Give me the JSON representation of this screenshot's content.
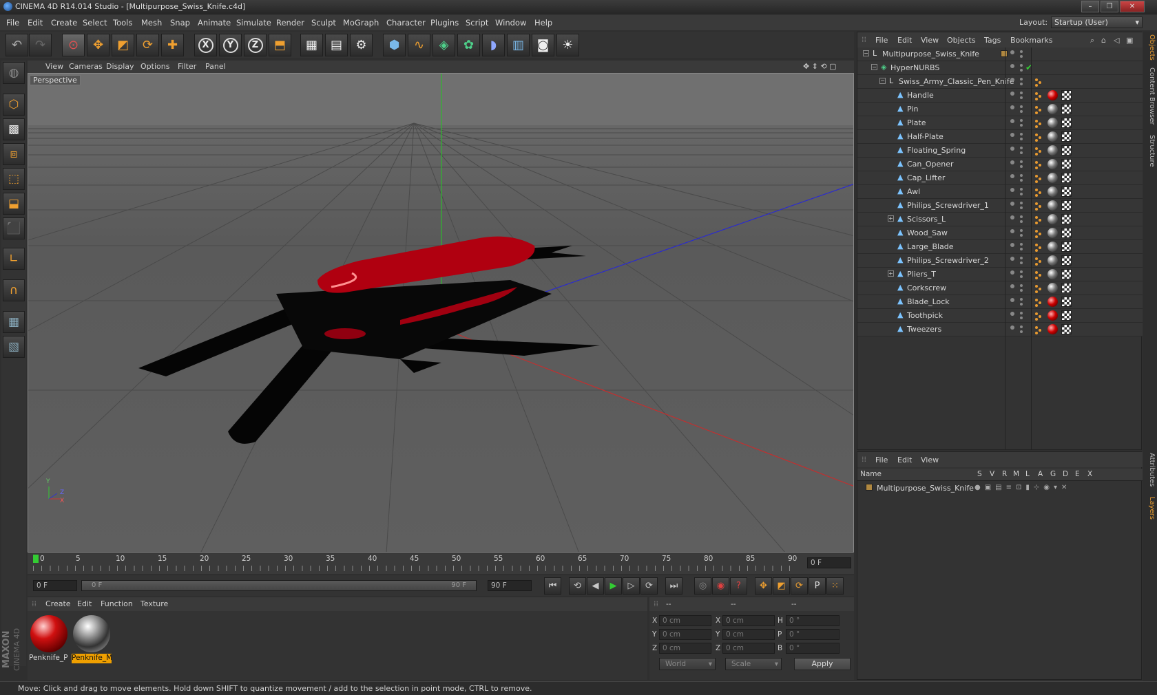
{
  "window": {
    "title": "CINEMA 4D R14.014 Studio - [Multipurpose_Swiss_Knife.c4d]",
    "controls": [
      "–",
      "❐",
      "✕"
    ]
  },
  "menubar": {
    "items": [
      "File",
      "Edit",
      "Create",
      "Select",
      "Tools",
      "Mesh",
      "Snap",
      "Animate",
      "Simulate",
      "Render",
      "Sculpt",
      "MoGraph",
      "Character",
      "Plugins",
      "Script",
      "Window",
      "Help"
    ],
    "layout_label": "Layout:",
    "layout_value": "Startup (User)"
  },
  "toolbar": {
    "icons": [
      "undo-icon",
      "redo-icon",
      "live-selection-icon",
      "move-icon",
      "scale-icon",
      "rotate-icon",
      "add-icon",
      "x-axis-icon",
      "y-axis-icon",
      "z-axis-icon",
      "coordinate-system-icon",
      "render-view-icon",
      "render-picture-viewer-icon",
      "render-settings-icon",
      "cube-icon",
      "spline-icon",
      "nurbs-icon",
      "array-icon",
      "deformer-icon",
      "floor-icon",
      "camera-icon",
      "light-icon"
    ],
    "axis_labels": [
      "X",
      "Y",
      "Z"
    ]
  },
  "viewport": {
    "menu": [
      "View",
      "Cameras",
      "Display",
      "Options",
      "Filter",
      "Panel"
    ],
    "label": "Perspective",
    "axis_labels": [
      "Y",
      "Z",
      "X"
    ]
  },
  "timeline": {
    "ticks": [
      "0",
      "5",
      "10",
      "15",
      "20",
      "25",
      "30",
      "35",
      "40",
      "45",
      "50",
      "55",
      "60",
      "65",
      "70",
      "75",
      "80",
      "85",
      "90"
    ],
    "current_frame": "0 F",
    "start_field": "0 F",
    "range_start": "0 F",
    "range_end": "90 F",
    "end_field": "90 F"
  },
  "materials": {
    "menu": [
      "Create",
      "Edit",
      "Function",
      "Texture"
    ],
    "items": [
      {
        "name": "Penknife_P",
        "selected": false
      },
      {
        "name": "Penknife_M",
        "selected": true
      }
    ]
  },
  "coordinates": {
    "headers": [
      "--",
      "--",
      "--"
    ],
    "rows": [
      {
        "a": "X",
        "av": "0 cm",
        "b": "X",
        "bv": "0 cm",
        "c": "H",
        "cv": "0 °"
      },
      {
        "a": "Y",
        "av": "0 cm",
        "b": "Y",
        "bv": "0 cm",
        "c": "P",
        "cv": "0 °"
      },
      {
        "a": "Z",
        "av": "0 cm",
        "b": "Z",
        "bv": "0 cm",
        "c": "B",
        "cv": "0 °"
      }
    ],
    "world": "World",
    "scale": "Scale",
    "apply": "Apply"
  },
  "objects": {
    "menu": [
      "File",
      "Edit",
      "View",
      "Objects",
      "Tags",
      "Bookmarks"
    ],
    "rows": [
      {
        "name": "Multipurpose_Swiss_Knife",
        "indent": 0,
        "icon": "null-icon",
        "tag": "none"
      },
      {
        "name": "HyperNURBS",
        "indent": 1,
        "icon": "hypernurbs-icon",
        "tag": "check"
      },
      {
        "name": "Swiss_Army_Classic_Pen_Knife",
        "indent": 2,
        "icon": "null-icon",
        "tag": "none"
      },
      {
        "name": "Handle",
        "indent": 3,
        "icon": "polygon-icon",
        "tag": "red"
      },
      {
        "name": "Pin",
        "indent": 3,
        "icon": "polygon-icon",
        "tag": "chrome"
      },
      {
        "name": "Plate",
        "indent": 3,
        "icon": "polygon-icon",
        "tag": "chrome"
      },
      {
        "name": "Half-Plate",
        "indent": 3,
        "icon": "polygon-icon",
        "tag": "chrome"
      },
      {
        "name": "Floating_Spring",
        "indent": 3,
        "icon": "polygon-icon",
        "tag": "chrome"
      },
      {
        "name": "Can_Opener",
        "indent": 3,
        "icon": "polygon-icon",
        "tag": "chrome"
      },
      {
        "name": "Cap_Lifter",
        "indent": 3,
        "icon": "polygon-icon",
        "tag": "chrome"
      },
      {
        "name": "Awl",
        "indent": 3,
        "icon": "polygon-icon",
        "tag": "chrome"
      },
      {
        "name": "Philips_Screwdriver_1",
        "indent": 3,
        "icon": "polygon-icon",
        "tag": "chrome"
      },
      {
        "name": "Scissors_L",
        "indent": 3,
        "icon": "polygon-icon",
        "tag": "chrome",
        "expand": true
      },
      {
        "name": "Wood_Saw",
        "indent": 3,
        "icon": "polygon-icon",
        "tag": "chrome"
      },
      {
        "name": "Large_Blade",
        "indent": 3,
        "icon": "polygon-icon",
        "tag": "chrome"
      },
      {
        "name": "Philips_Screwdriver_2",
        "indent": 3,
        "icon": "polygon-icon",
        "tag": "chrome"
      },
      {
        "name": "Pliers_T",
        "indent": 3,
        "icon": "polygon-icon",
        "tag": "chrome",
        "expand": true
      },
      {
        "name": "Corkscrew",
        "indent": 3,
        "icon": "polygon-icon",
        "tag": "chrome"
      },
      {
        "name": "Blade_Lock",
        "indent": 3,
        "icon": "polygon-icon",
        "tag": "red"
      },
      {
        "name": "Toothpick",
        "indent": 3,
        "icon": "polygon-icon",
        "tag": "red"
      },
      {
        "name": "Tweezers",
        "indent": 3,
        "icon": "polygon-icon",
        "tag": "red"
      }
    ]
  },
  "layers": {
    "menu": [
      "File",
      "Edit",
      "View"
    ],
    "columns": [
      "Name",
      "S",
      "V",
      "R",
      "M",
      "L",
      "A",
      "G",
      "D",
      "E",
      "X"
    ],
    "rows": [
      {
        "name": "Multipurpose_Swiss_Knife"
      }
    ]
  },
  "right_tabs": [
    "Objects",
    "Content Browser",
    "Structure",
    "Attributes",
    "Layers"
  ],
  "status": {
    "text": "Move: Click and drag to move elements. Hold down SHIFT to quantize movement / add to the selection in point mode, CTRL to remove."
  },
  "brand": {
    "line1": "MAXON",
    "line2": "CINEMA 4D"
  },
  "colors": {
    "accent": "#f0a030",
    "handle_red": "#b00010",
    "selected_material": "#f0a000"
  }
}
